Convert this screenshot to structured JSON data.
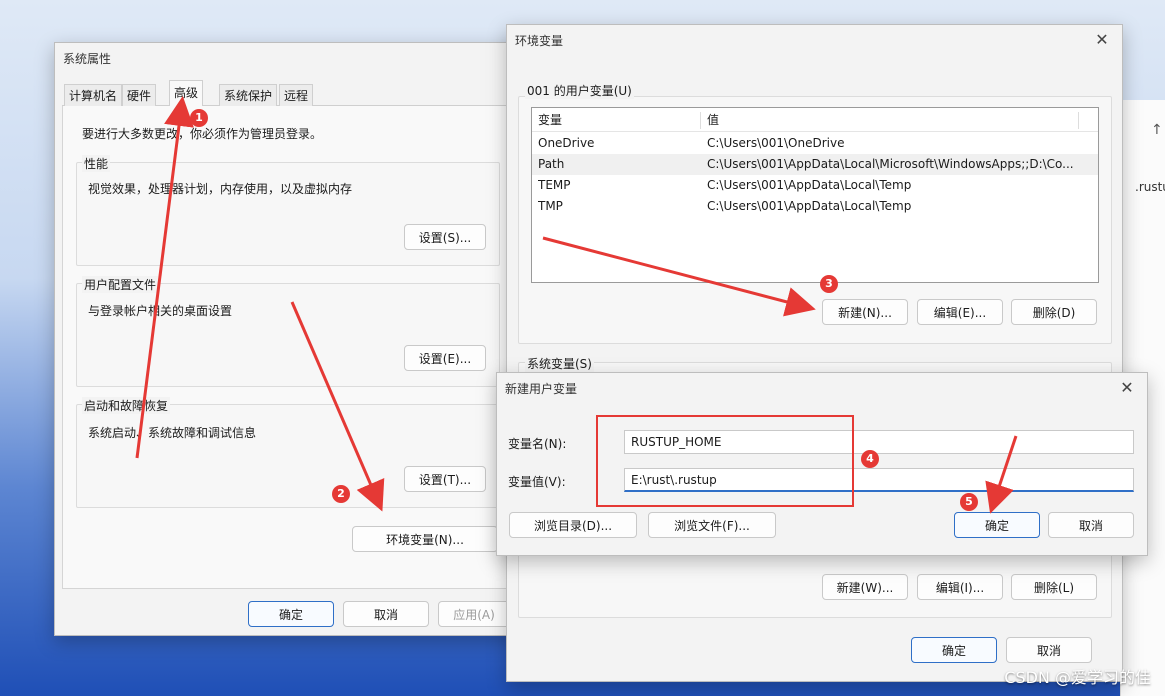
{
  "sys_props": {
    "title": "系统属性",
    "tabs": [
      "计算机名",
      "硬件",
      "高级",
      "系统保护",
      "远程"
    ],
    "admin_note": "要进行大多数更改，你必须作为管理员登录。",
    "perf": {
      "label": "性能",
      "desc": "视觉效果，处理器计划，内存使用，以及虚拟内存",
      "button": "设置(S)..."
    },
    "profile": {
      "label": "用户配置文件",
      "desc": "与登录帐户相关的桌面设置",
      "button": "设置(E)..."
    },
    "startup": {
      "label": "启动和故障恢复",
      "desc": "系统启动、系统故障和调试信息",
      "button": "设置(T)..."
    },
    "env_button": "环境变量(N)...",
    "ok": "确定",
    "cancel": "取消",
    "apply": "应用(A)"
  },
  "env": {
    "title": "环境变量",
    "user_group": "001 的用户变量(U)",
    "col_var": "变量",
    "col_val": "值",
    "rows": [
      {
        "var": "OneDrive",
        "val": "C:\\Users\\001\\OneDrive"
      },
      {
        "var": "Path",
        "val": "C:\\Users\\001\\AppData\\Local\\Microsoft\\WindowsApps;;D:\\Co..."
      },
      {
        "var": "TEMP",
        "val": "C:\\Users\\001\\AppData\\Local\\Temp"
      },
      {
        "var": "TMP",
        "val": "C:\\Users\\001\\AppData\\Local\\Temp"
      }
    ],
    "new_user": "新建(N)...",
    "edit_user": "编辑(E)...",
    "delete_user": "删除(D)",
    "system_group": "系统变量(S)",
    "new_sys": "新建(W)...",
    "edit_sys": "编辑(I)...",
    "delete_sys": "删除(L)",
    "ok": "确定",
    "cancel": "取消"
  },
  "newvar": {
    "title": "新建用户变量",
    "name_label": "变量名(N):",
    "name_value": "RUSTUP_HOME",
    "value_label": "变量值(V):",
    "value_value": "E:\\rust\\.rustup",
    "browse_dir": "浏览目录(D)...",
    "browse_file": "浏览文件(F)...",
    "ok": "确定",
    "cancel": "取消"
  },
  "bg_fragment": ".rustu",
  "badges": [
    "1",
    "2",
    "3",
    "4",
    "5"
  ],
  "watermark": "CSDN @爱学习的佳",
  "colors": {
    "annotation": "#e53935",
    "accent": "#2f6fc7"
  }
}
